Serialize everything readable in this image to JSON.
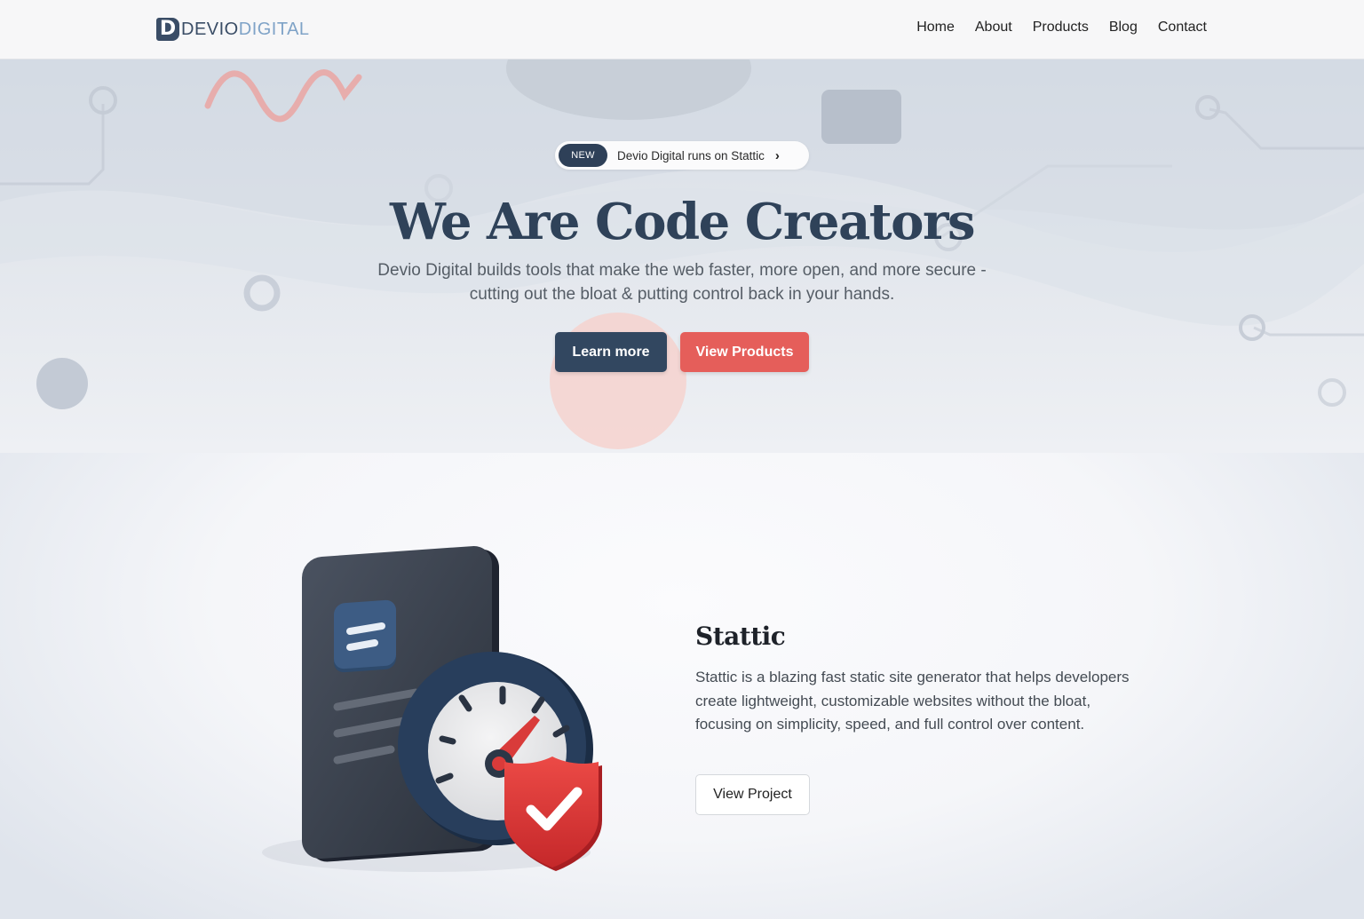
{
  "nav": {
    "logo_mark": "D",
    "logo_part1": "DEVIO",
    "logo_part2": "DIGITAL",
    "links": [
      "Home",
      "About",
      "Products",
      "Blog",
      "Contact"
    ]
  },
  "hero": {
    "badge": "NEW",
    "announcement": "Devio Digital runs on Stattic",
    "title": "We Are Code Creators",
    "subtitle_line1": "Devio Digital builds tools that make the web faster, more open, and more secure -",
    "subtitle_line2": "cutting out the bloat & putting control back in your hands.",
    "learn_more": "Learn more",
    "view_products": "View Products"
  },
  "product": {
    "title": "Stattic",
    "description": "Stattic is a blazing fast static site generator that helps developers create lightweight, customizable websites without the bloat, focusing on simplicity, speed, and full control over content.",
    "button": "View Project",
    "icon": "document-speedometer-shield-icon"
  },
  "colors": {
    "primary": "#324760",
    "accent": "#e55e5a",
    "title": "#2f4259"
  }
}
